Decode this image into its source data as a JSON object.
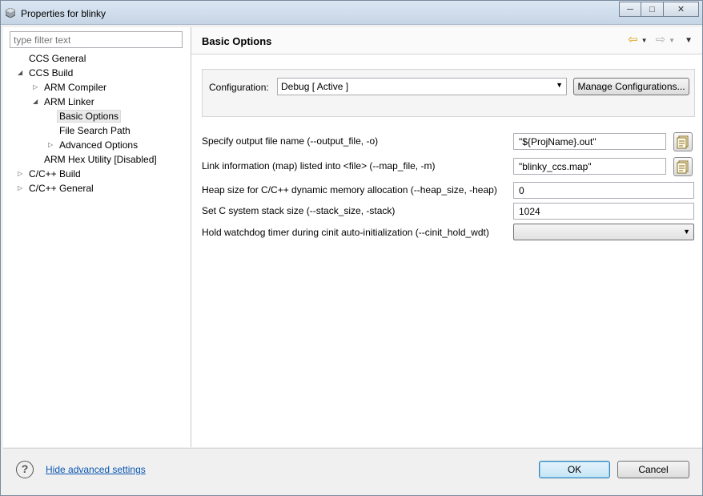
{
  "window": {
    "title": "Properties for blinky"
  },
  "filter": {
    "placeholder": "type filter text"
  },
  "tree": {
    "items": [
      {
        "label": "CCS General"
      },
      {
        "label": "CCS Build"
      },
      {
        "label": "ARM Compiler"
      },
      {
        "label": "ARM Linker"
      },
      {
        "label": "Basic Options"
      },
      {
        "label": "File Search Path"
      },
      {
        "label": "Advanced Options"
      },
      {
        "label": "ARM Hex Utility  [Disabled]"
      },
      {
        "label": "C/C++ Build"
      },
      {
        "label": "C/C++ General"
      }
    ]
  },
  "page": {
    "title": "Basic Options"
  },
  "config": {
    "label": "Configuration:",
    "value": "Debug  [ Active ]",
    "manage_label": "Manage Configurations..."
  },
  "options": [
    {
      "label": "Specify output file name (--output_file, -o)",
      "value": "\"${ProjName}.out\""
    },
    {
      "label": "Link information (map) listed into <file> (--map_file, -m)",
      "value": "\"blinky_ccs.map\""
    },
    {
      "label": "Heap size for C/C++ dynamic memory allocation (--heap_size, -heap)",
      "value": "0"
    },
    {
      "label": "Set C system stack size (--stack_size, -stack)",
      "value": "1024"
    },
    {
      "label": "Hold watchdog timer during cinit auto-initialization (--cinit_hold_wdt)",
      "value": ""
    }
  ],
  "footer": {
    "help_glyph": "?",
    "advanced_link": "Hide advanced settings",
    "ok_label": "OK",
    "cancel_label": "Cancel"
  },
  "colors": {
    "link": "#0b57b3",
    "nav_arrow": "#e0a010"
  }
}
